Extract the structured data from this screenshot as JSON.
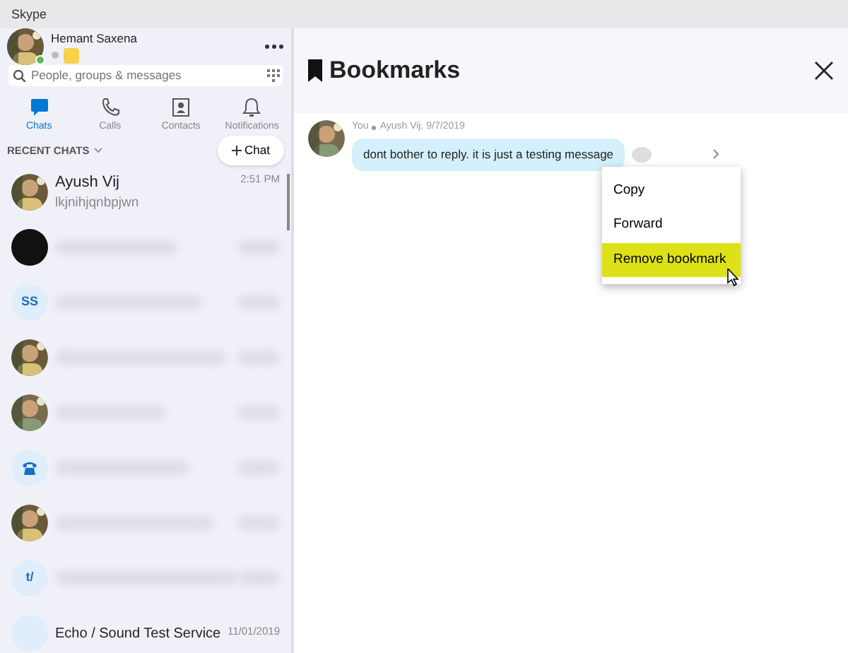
{
  "window": {
    "title": "Skype"
  },
  "profile": {
    "name": "Hemant Saxena",
    "online": true
  },
  "search": {
    "placeholder": "People, groups & messages"
  },
  "tabs": [
    {
      "label": "Chats",
      "selected": true
    },
    {
      "label": "Calls",
      "selected": false
    },
    {
      "label": "Contacts",
      "selected": false
    },
    {
      "label": "Notifications",
      "selected": false
    }
  ],
  "recent_chats": {
    "label": "RECENT CHATS",
    "new_chat": "Chat"
  },
  "chats": [
    {
      "kind": "text",
      "name": "Ayush Vij",
      "preview": "lkjnihjqnbpjwn",
      "time": "2:51 PM"
    },
    {
      "kind": "blurred",
      "avatar": {
        "kind": "dark"
      }
    },
    {
      "kind": "blurred",
      "avatar": {
        "kind": "initials",
        "initials": "SS"
      }
    },
    {
      "kind": "blurred"
    },
    {
      "kind": "blurred"
    },
    {
      "kind": "blurred",
      "avatar": {
        "kind": "phone"
      }
    },
    {
      "kind": "blurred"
    },
    {
      "kind": "blurred",
      "avatar": {
        "kind": "initials",
        "initials": "t/"
      }
    },
    {
      "kind": "text",
      "avatar": {
        "kind": "initials"
      },
      "name": "Echo / Sound Test Service",
      "time": "11/01/2019"
    }
  ],
  "bookmarks": {
    "title": "Bookmarks",
    "message": {
      "sender": "You",
      "chat": "Ayush Vij, 9/7/2019",
      "text": "dont bother to reply. it is just a testing message"
    },
    "menu": [
      {
        "label": "Copy",
        "selected": false
      },
      {
        "label": "Forward",
        "selected": false
      },
      {
        "label": "Remove bookmark",
        "selected": true
      }
    ]
  }
}
